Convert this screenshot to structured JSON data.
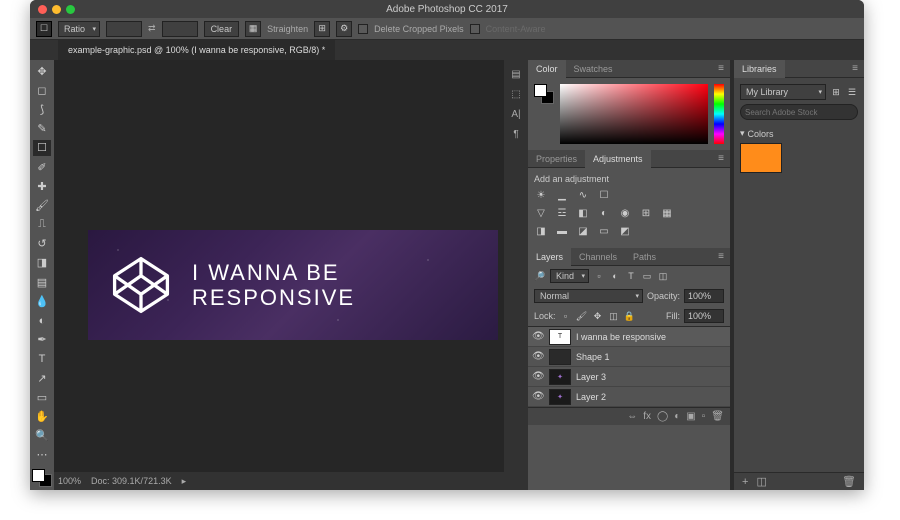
{
  "title": "Adobe Photoshop CC 2017",
  "optbar": {
    "mode": "Ratio",
    "clear": "Clear",
    "straighten": "Straighten",
    "delete_cropped": "Delete Cropped Pixels",
    "content_aware": "Content-Aware"
  },
  "tab": "example-graphic.psd @ 100% (I wanna be responsive, RGB/8) *",
  "artwork": {
    "line1": "I WANNA BE",
    "line2": "RESPONSIVE"
  },
  "status": {
    "zoom": "100%",
    "doc": "Doc: 309.1K/721.3K"
  },
  "panel_tabs": {
    "color": "Color",
    "swatches": "Swatches",
    "properties": "Properties",
    "adjustments": "Adjustments",
    "layers": "Layers",
    "channels": "Channels",
    "paths": "Paths",
    "libraries": "Libraries"
  },
  "adjustments": {
    "title": "Add an adjustment"
  },
  "layers_panel": {
    "kind": "Kind",
    "blend": "Normal",
    "opacity_lbl": "Opacity:",
    "opacity": "100%",
    "lock_lbl": "Lock:",
    "fill_lbl": "Fill:",
    "fill": "100%",
    "items": [
      {
        "name": "I wanna be responsive",
        "selected": true,
        "thumb": "T"
      },
      {
        "name": "Shape 1",
        "thumb": "shape"
      },
      {
        "name": "Layer 3",
        "thumb": "dark"
      },
      {
        "name": "Layer 2",
        "thumb": "dark"
      }
    ]
  },
  "libraries": {
    "selected": "My Library",
    "search_ph": "Search Adobe Stock",
    "section": "Colors"
  }
}
